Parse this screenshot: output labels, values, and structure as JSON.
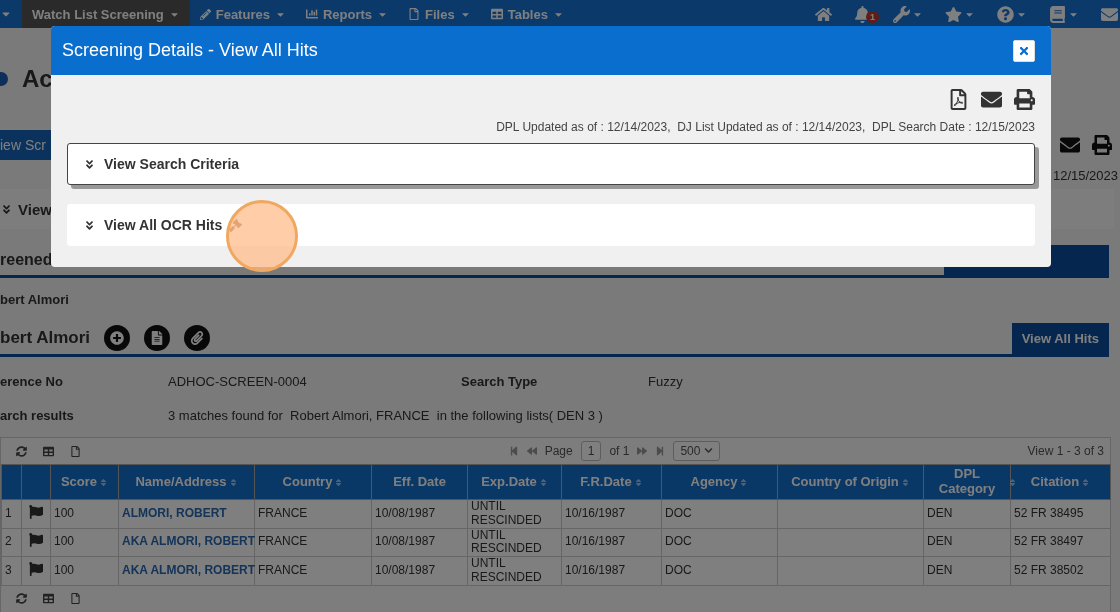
{
  "nav": {
    "items": [
      {
        "label": "Watch List Screening",
        "selected": true
      },
      {
        "label": "Features",
        "selected": false
      },
      {
        "label": "Reports",
        "selected": false
      },
      {
        "label": "Files",
        "selected": false
      },
      {
        "label": "Tables",
        "selected": false
      }
    ],
    "notification_count": "1"
  },
  "page": {
    "title": "Ac",
    "new_button": "iew Scr",
    "date": "12/15/2023",
    "accordion": "View",
    "section_title": "reened",
    "entity_small": "bert Almori",
    "entity_title": "bert Almori",
    "hits_button": "View All Hits",
    "details": [
      {
        "label": "erence No",
        "value": "ADHOC-SCREEN-0004",
        "label2": "Search Type",
        "value2": "Fuzzy"
      },
      {
        "label": "arch results",
        "value": "3 matches found for  Robert Almori, FRANCE  in the following lists( DEN 3 )"
      }
    ],
    "grid": {
      "pager": {
        "page_label": "Page",
        "page": "1",
        "of": "of 1",
        "size": "500",
        "summary": "View 1 - 3 of 3"
      },
      "columns": [
        {
          "label": "Score",
          "sortable": true
        },
        {
          "label": "Name/Address",
          "sortable": true
        },
        {
          "label": "Country",
          "sortable": true
        },
        {
          "label": "Eff. Date",
          "sortable": false
        },
        {
          "label": "Exp.Date",
          "sortable": true
        },
        {
          "label": "F.R.Date",
          "sortable": true
        },
        {
          "label": "Agency",
          "sortable": true
        },
        {
          "label": "Country of Origin",
          "sortable": true
        },
        {
          "label": "DPL Category",
          "sortable": true
        },
        {
          "label": "Citation",
          "sortable": true
        }
      ],
      "rows": [
        {
          "number": "1",
          "cells": [
            "100",
            "ALMORI, ROBERT",
            "FRANCE",
            "10/08/1987",
            "UNTIL RESCINDED",
            "10/16/1987",
            "DOC",
            "",
            "DEN",
            "52 FR 38495"
          ]
        },
        {
          "number": "2",
          "cells": [
            "100",
            "AKA ALMORI, ROBERT",
            "FRANCE",
            "10/08/1987",
            "UNTIL RESCINDED",
            "10/16/1987",
            "DOC",
            "",
            "DEN",
            "52 FR 38497"
          ]
        },
        {
          "number": "3",
          "cells": [
            "100",
            "AKA ALMORI, ROBERT",
            "FRANCE",
            "10/08/1987",
            "UNTIL RESCINDED",
            "10/16/1987",
            "DOC",
            "",
            "DEN",
            "52 FR 38502"
          ]
        }
      ]
    }
  },
  "modal": {
    "title": "Screening Details - View All Hits",
    "dates": "DPL Updated as of : 12/14/2023,  DJ List Updated as of : 12/14/2023,  DPL Search Date : 12/15/2023",
    "accordions": [
      {
        "label": "View Search Criteria",
        "focused": true
      },
      {
        "label": "View All OCR Hits",
        "focused": false
      }
    ]
  }
}
